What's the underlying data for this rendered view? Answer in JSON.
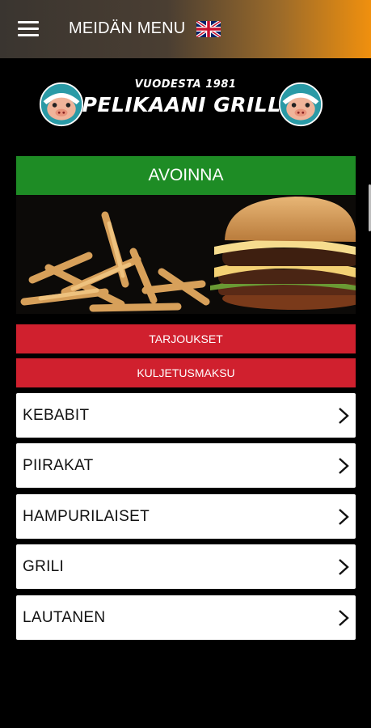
{
  "header": {
    "title": "MEIDÄN MENU",
    "menu_icon": "hamburger-menu-icon",
    "language_icon": "uk-flag-icon"
  },
  "logo": {
    "tagline": "VUODESTA 1981",
    "name": "PELIKAANI GRILLI"
  },
  "status": {
    "label": "AVOINNA",
    "color": "#1e8c25"
  },
  "hero": {
    "image": "burger-and-fries-photo"
  },
  "actions": [
    {
      "label": "TARJOUKSET"
    },
    {
      "label": "KULJETUSMAKSU"
    }
  ],
  "categories": [
    {
      "label": "KEBABIT"
    },
    {
      "label": "PIIRAKAT"
    },
    {
      "label": "HAMPURILAISET"
    },
    {
      "label": "GRILI"
    },
    {
      "label": "LAUTANEN"
    }
  ],
  "colors": {
    "accent_red": "#d0202e",
    "header_orange": "#f0900e",
    "background": "#000000"
  }
}
